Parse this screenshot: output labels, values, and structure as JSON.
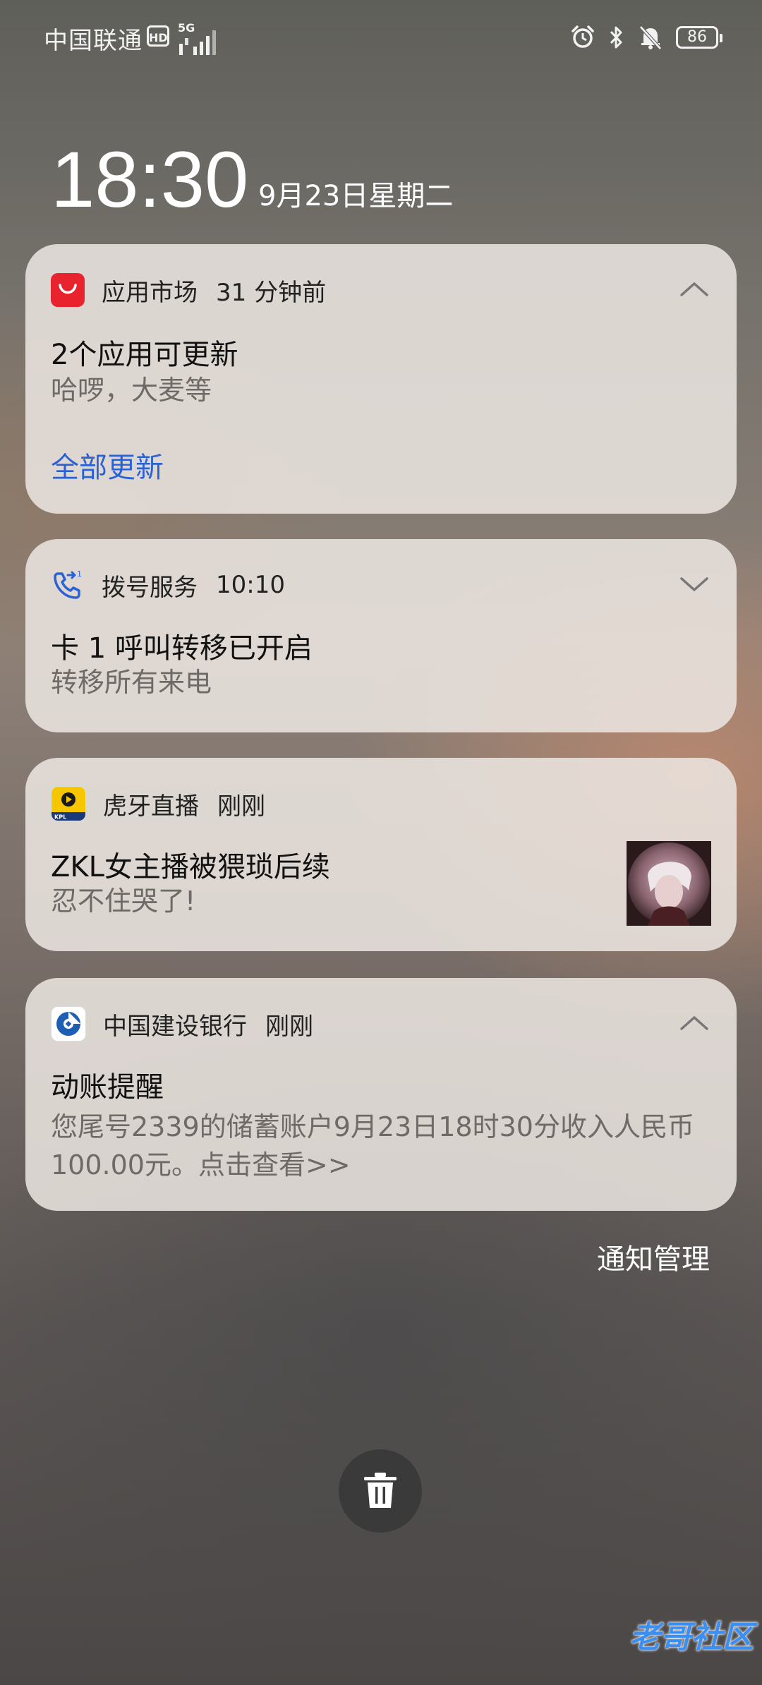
{
  "status_bar": {
    "carrier": "中国联通",
    "hd_badge": "HD",
    "network_type": "5G",
    "battery_level": "86",
    "icons": [
      "alarm-icon",
      "bluetooth-icon",
      "bell-muted-icon"
    ]
  },
  "lock_screen": {
    "time": "18:30",
    "date": "9月23日星期二"
  },
  "notifications": [
    {
      "app_name": "应用市场",
      "time": "31 分钟前",
      "title": "2个应用可更新",
      "body": "哈啰，大麦等",
      "action": "全部更新",
      "expanded": true,
      "icon": "app-market-icon"
    },
    {
      "app_name": "拨号服务",
      "time": "10:10",
      "title": "卡 1 呼叫转移已开启",
      "body": "转移所有来电",
      "expanded": false,
      "icon": "call-forward-icon"
    },
    {
      "app_name": "虎牙直播",
      "time": "刚刚",
      "title": "ZKL女主播被猥琐后续",
      "body": "忍不住哭了!",
      "icon": "huya-icon",
      "has_thumbnail": true
    },
    {
      "app_name": "中国建设银行",
      "time": "刚刚",
      "title": "动账提醒",
      "body": "您尾号2339的储蓄账户9月23日18时30分收入人民币100.00元。点击查看>>",
      "expanded": true,
      "icon": "ccb-icon"
    }
  ],
  "footer": {
    "manage_label": "通知管理",
    "clear_icon": "trash-icon",
    "watermark": "老哥社区"
  },
  "colors": {
    "action_blue": "#2a62d6",
    "card_bg": "#ece6e2",
    "app_market_red": "#e8232d",
    "huya_yellow": "#f6c700",
    "ccb_blue": "#1e5fb4"
  }
}
